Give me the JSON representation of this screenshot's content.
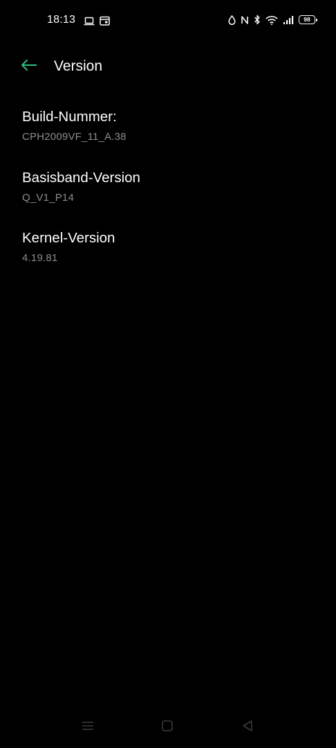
{
  "status_bar": {
    "time": "18:13",
    "battery_level": "98",
    "left_icons": [
      "laptop-icon",
      "calendar-icon"
    ],
    "right_icons": [
      "water-drop-icon",
      "nfc-icon",
      "bluetooth-icon",
      "wifi-icon",
      "signal-icon",
      "battery-icon"
    ]
  },
  "header": {
    "title": "Version",
    "back_icon": "back-arrow-icon",
    "accent_color": "#2fbf7a"
  },
  "items": [
    {
      "title": "Build-Nummer:",
      "value": "CPH2009VF_11_A.38"
    },
    {
      "title": "Basisband-Version",
      "value": "Q_V1_P14"
    },
    {
      "title": "Kernel-Version",
      "value": "4.19.81"
    }
  ],
  "nav_bar": {
    "buttons": [
      "menu-icon",
      "home-icon",
      "back-icon"
    ]
  }
}
